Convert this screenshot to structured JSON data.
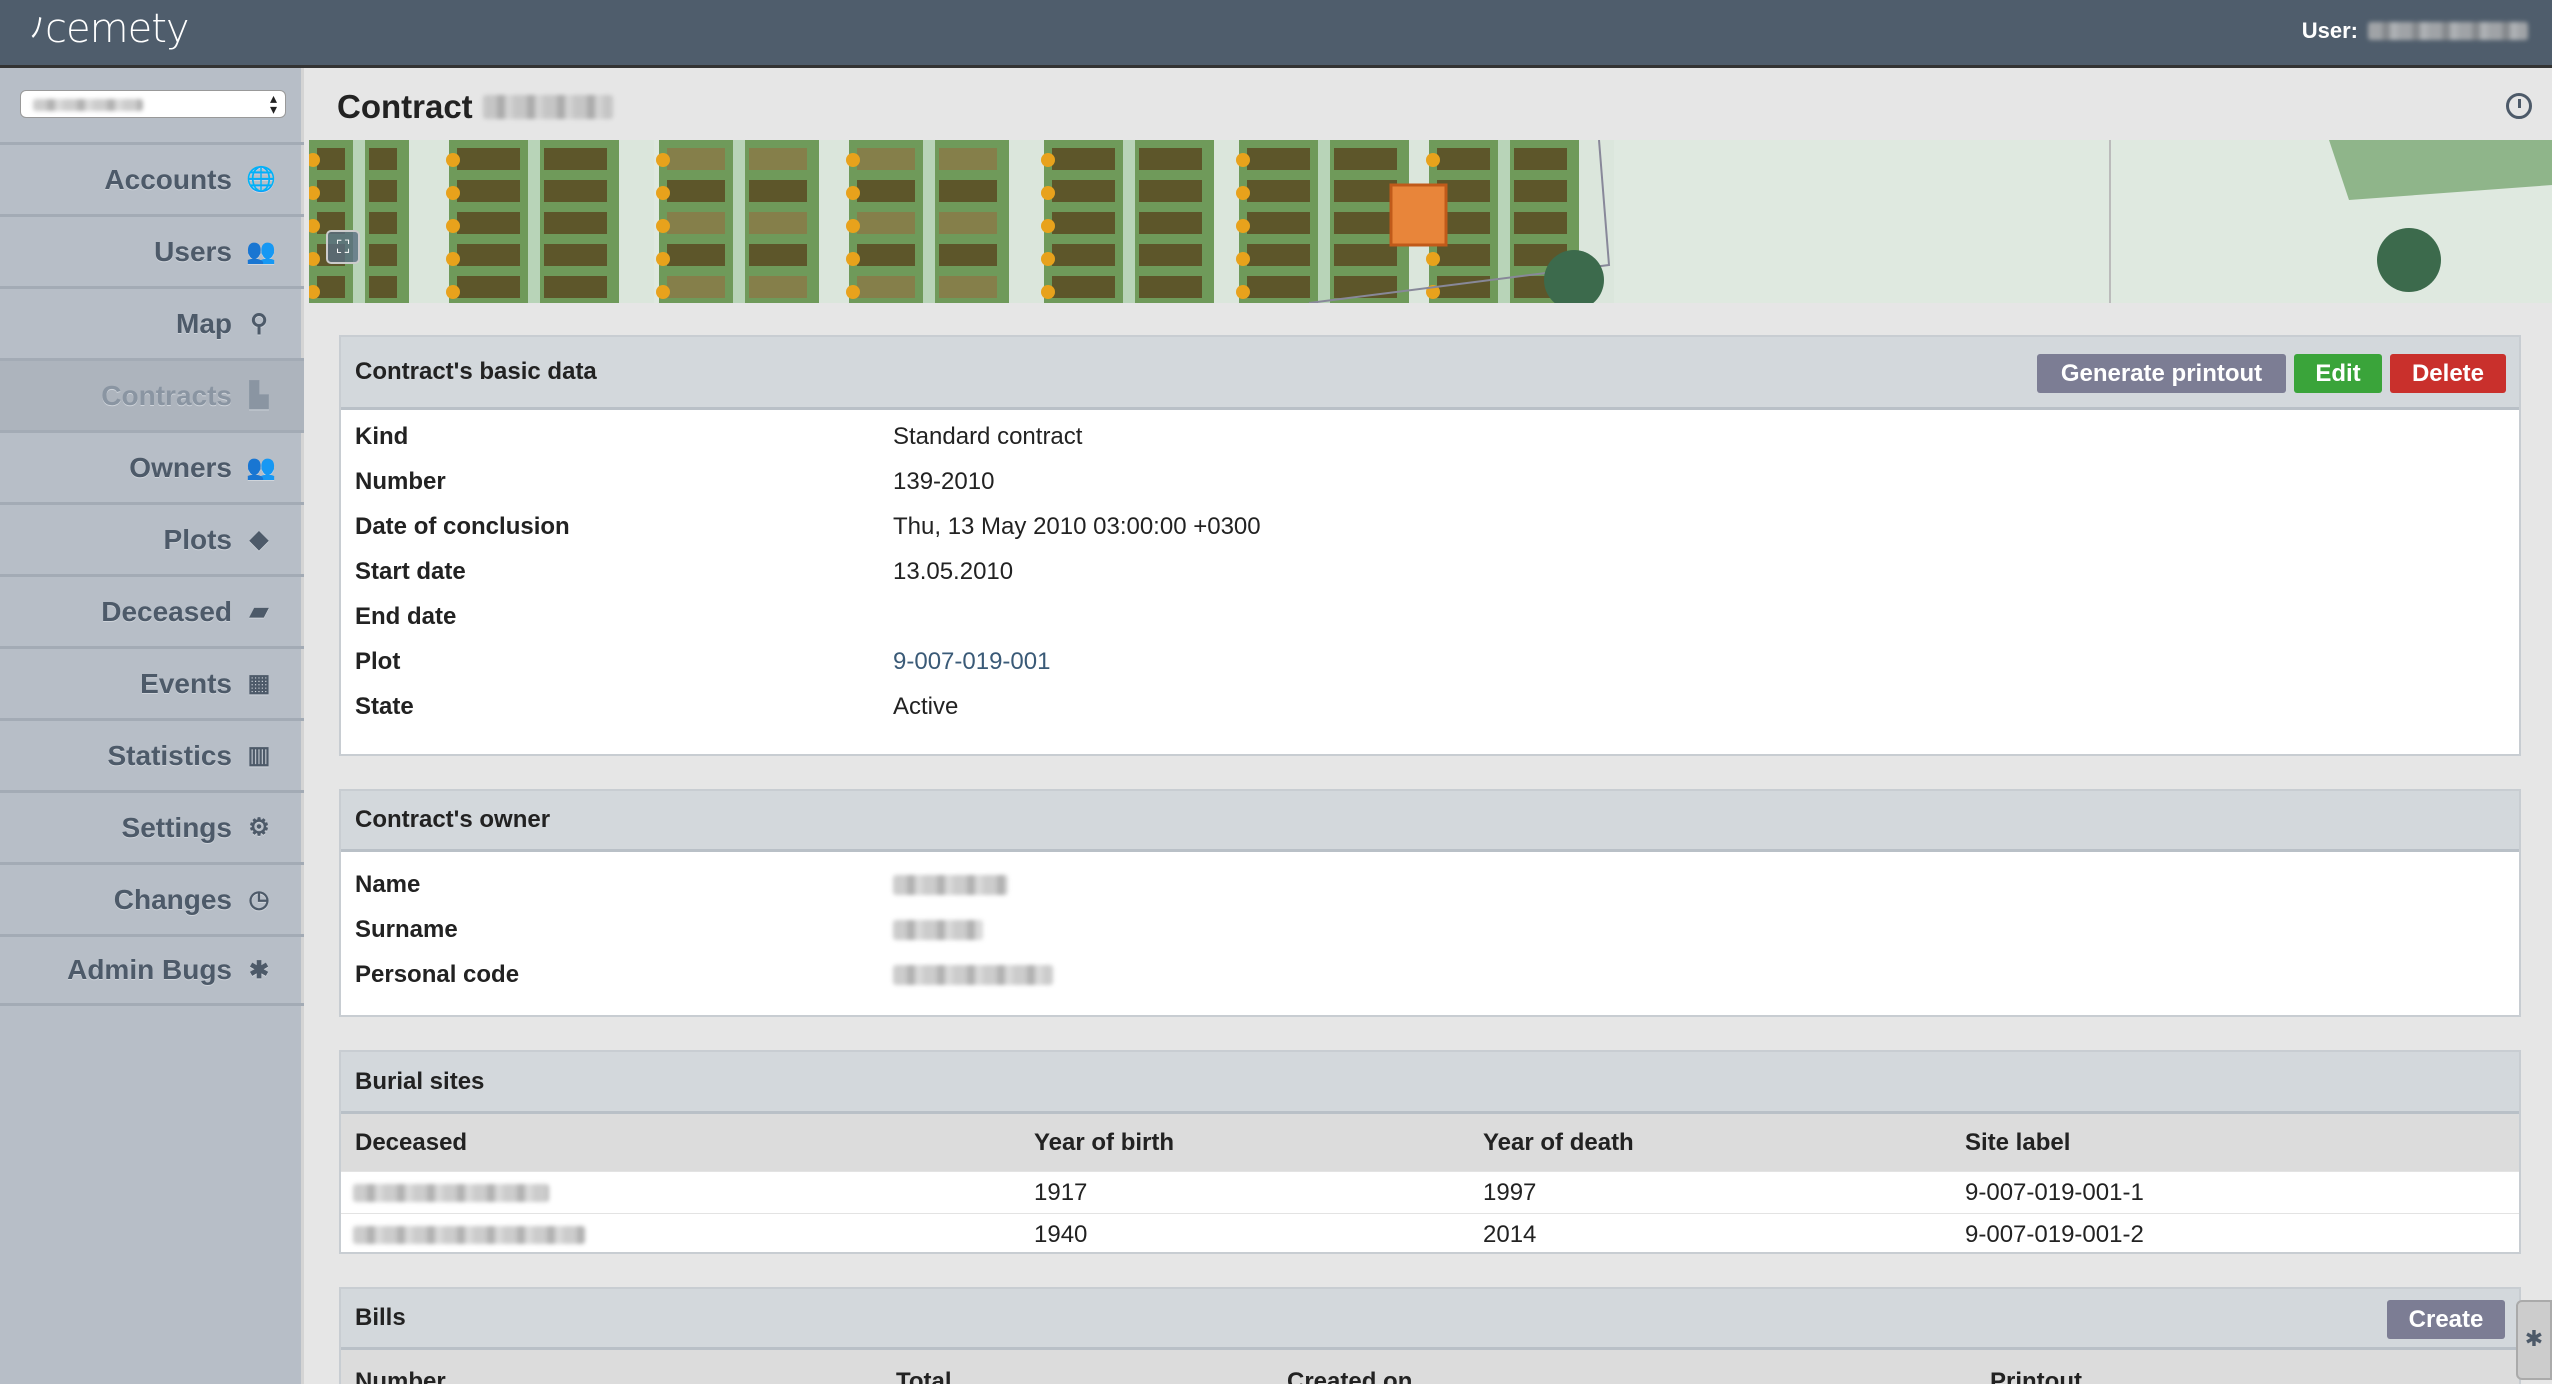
{
  "app": {
    "logo": "cemety",
    "user_label": "User:"
  },
  "sidebar": {
    "items": [
      {
        "label": "Accounts",
        "icon": "globe-icon",
        "glyph": "🌐"
      },
      {
        "label": "Users",
        "icon": "users-icon",
        "glyph": "👥"
      },
      {
        "label": "Map",
        "icon": "map-marker-icon",
        "glyph": "⚲"
      },
      {
        "label": "Contracts",
        "icon": "file-icon",
        "glyph": "▙",
        "active": true
      },
      {
        "label": "Owners",
        "icon": "users-icon",
        "glyph": "👥"
      },
      {
        "label": "Plots",
        "icon": "tag-icon",
        "glyph": "◆"
      },
      {
        "label": "Deceased",
        "icon": "book-icon",
        "glyph": "▰"
      },
      {
        "label": "Events",
        "icon": "calendar-icon",
        "glyph": "▦"
      },
      {
        "label": "Statistics",
        "icon": "bar-chart-icon",
        "glyph": "▥"
      },
      {
        "label": "Settings",
        "icon": "cogs-icon",
        "glyph": "⚙"
      },
      {
        "label": "Changes",
        "icon": "clock-icon",
        "glyph": "◷"
      },
      {
        "label": "Admin Bugs",
        "icon": "bug-icon",
        "glyph": "✱"
      }
    ]
  },
  "page": {
    "title": "Contract"
  },
  "basic": {
    "title": "Contract's basic data",
    "buttons": {
      "printout": "Generate printout",
      "edit": "Edit",
      "delete": "Delete"
    },
    "colors": {
      "printout": "#7c7d94",
      "edit": "#3aa43a",
      "delete": "#c9302c"
    },
    "rows": [
      {
        "label": "Kind",
        "value": "Standard contract"
      },
      {
        "label": "Number",
        "value": "139-2010"
      },
      {
        "label": "Date of conclusion",
        "value": "Thu, 13 May 2010 03:00:00 +0300"
      },
      {
        "label": "Start date",
        "value": "13.05.2010"
      },
      {
        "label": "End date",
        "value": ""
      },
      {
        "label": "Plot",
        "value": "9-007-019-001"
      },
      {
        "label": "State",
        "value": "Active"
      }
    ]
  },
  "owner": {
    "title": "Contract's owner",
    "rows": [
      {
        "label": "Name"
      },
      {
        "label": "Surname"
      },
      {
        "label": "Personal code"
      }
    ]
  },
  "burial": {
    "title": "Burial sites",
    "headers": [
      "Deceased",
      "Year of birth",
      "Year of death",
      "Site label"
    ],
    "rows": [
      {
        "birth": "1917",
        "death": "1997",
        "site": "9-007-019-001-1"
      },
      {
        "birth": "1940",
        "death": "2014",
        "site": "9-007-019-001-2"
      }
    ]
  },
  "bills": {
    "title": "Bills",
    "create": "Create",
    "headers": [
      "Number",
      "Total",
      "Created on",
      "Printout"
    ]
  }
}
